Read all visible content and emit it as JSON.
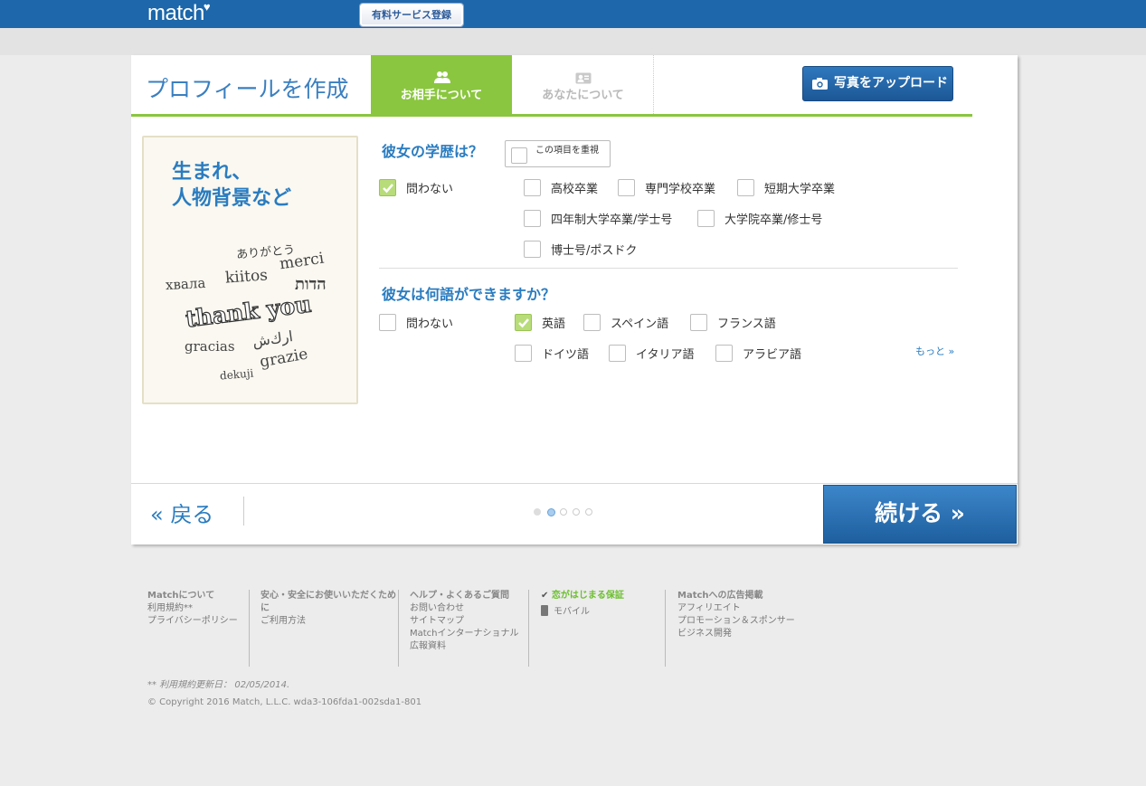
{
  "header": {
    "logo": "match",
    "premium_button": "有料サービス登録"
  },
  "profile": {
    "title": "プロフィールを作成",
    "tabs": [
      {
        "label": "お相手について",
        "icon": "people-icon",
        "active": true
      },
      {
        "label": "あなたについて",
        "icon": "profile-card-icon",
        "active": false
      }
    ],
    "upload_button": "写真をアップロード",
    "side_panel": {
      "title_line1": "生まれ、",
      "title_line2": "人物背景など",
      "words": [
        "ありがとう",
        "merci",
        "хвала",
        "kiitos",
        "הדות",
        "thank you",
        "gracias",
        "ارك‌ش",
        "grazie",
        "dekuji"
      ]
    }
  },
  "education": {
    "question": "彼女の学歴は？",
    "important_label": "この項目を重視",
    "options": [
      {
        "label": "問わない",
        "checked": true
      },
      {
        "label": "高校卒業",
        "checked": false
      },
      {
        "label": "専門学校卒業",
        "checked": false
      },
      {
        "label": "短期大学卒業",
        "checked": false
      },
      {
        "label": "四年制大学卒業/学士号",
        "checked": false
      },
      {
        "label": "大学院卒業/修士号",
        "checked": false
      },
      {
        "label": "博士号/ポスドク",
        "checked": false
      }
    ]
  },
  "languages": {
    "question": "彼女は何語ができますか？",
    "options": [
      {
        "label": "問わない",
        "checked": false
      },
      {
        "label": "英語",
        "checked": true
      },
      {
        "label": "スペイン語",
        "checked": false
      },
      {
        "label": "フランス語",
        "checked": false
      },
      {
        "label": "ドイツ語",
        "checked": false
      },
      {
        "label": "イタリア語",
        "checked": false
      },
      {
        "label": "アラビア語",
        "checked": false
      }
    ],
    "more_link": "もっと »"
  },
  "navigation": {
    "back": "« 戻る",
    "continue": "続ける »",
    "progress": {
      "current": 2,
      "total": 5
    }
  },
  "footer": {
    "col1": {
      "heading": "Matchについて",
      "links": [
        "利用規約**",
        "プライバシーポリシー"
      ]
    },
    "col2": {
      "heading": "安心・安全にお使いいただくため",
      "heading2": "に",
      "links": [
        "ご利用方法"
      ]
    },
    "col3": {
      "heading": "ヘルプ・よくあるご質問",
      "links": [
        "お問い合わせ",
        "サイトマップ",
        "Matchインターナショナル",
        "広報資料"
      ]
    },
    "col4": {
      "heading": "恋がはじまる保証",
      "links": [
        "モバイル"
      ]
    },
    "col5": {
      "heading": "Matchへの広告掲載",
      "links": [
        "アフィリエイト",
        "プロモーション＆スポンサー",
        "ビジネス開発"
      ]
    },
    "terms_note": "** 利用規約更新日： 02/05/2014.",
    "copyright": "© Copyright 2016 Match, L.L.C. wda3-106fda1-002sda1-801"
  },
  "colors": {
    "brand_blue": "#1d67aa",
    "accent_green": "#8ac63f",
    "link_blue": "#2a7cc0"
  }
}
